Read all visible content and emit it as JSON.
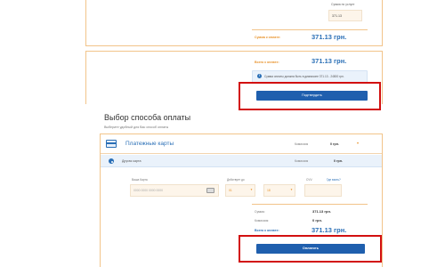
{
  "top_card": {
    "sum_label": "Сумма по услуге",
    "sum_value": "371.13",
    "pay_label": "Сумма к оплате:",
    "pay_amount": "371.13 грн."
  },
  "summary_card": {
    "total_label": "Всего к оплате:",
    "total_amount": "371.13 грн.",
    "info_text": "Сумма оплаты должна быть в диапазоне 371.13 - 24800 грн.",
    "confirm_button": "Подтвердить"
  },
  "payment_section": {
    "title": "Выбор способа оплаты",
    "subtitle": "Выберите удобный для Вас способ оплаты",
    "methods_title": "Платежные карты",
    "commission_label": "Комиссия",
    "commission_value": "0 грн.",
    "other_card_label": "Другая карта",
    "other_commission_value": "0 грн."
  },
  "card_form": {
    "card_number_label": "Ваша Карта",
    "card_number_placeholder": "0000 0000 0000 0000",
    "expiry_label": "Действует до",
    "expiry_month": "01",
    "expiry_year": "18",
    "cvv_label": "CVV:",
    "cvv_help": "Где взять?"
  },
  "totals": {
    "sum_label": "Сумма:",
    "sum_value": "371.13 грн.",
    "commission_label": "Комиссия:",
    "commission_value": "0 грн.",
    "total_label": "Всего к оплате:",
    "total_amount": "371.13 грн.",
    "pay_button": "Оплатить"
  },
  "colors": {
    "accent_orange": "#e8932c",
    "brand_blue": "#2a6fb6",
    "button_blue": "#1f5fae",
    "highlight_red": "#d21010"
  }
}
